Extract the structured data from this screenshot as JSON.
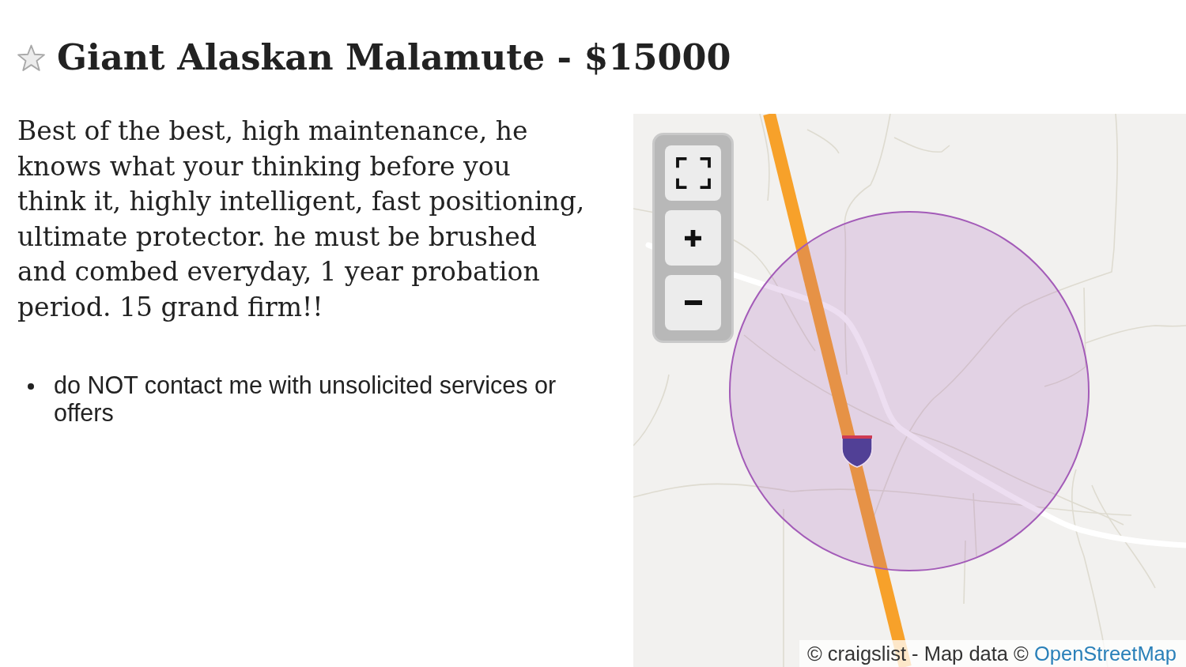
{
  "listing": {
    "starred": false,
    "title": "Giant Alaskan Malamute - $15000"
  },
  "description": "Best of the best, high maintenance, he knows what your thinking before you think it, highly intelligent, fast positioning, ultimate protector. he must be brushed and combed everyday, 1 year probation period. 15 grand firm!!",
  "notices": [
    "do NOT contact me with unsolicited services or offers"
  ],
  "map": {
    "controls": [
      {
        "kind": "fullscreen"
      },
      {
        "kind": "zoom_in"
      },
      {
        "kind": "zoom_out"
      }
    ],
    "attribution": {
      "text": "© craigslist - Map data ©",
      "link": "OpenStreetMap"
    }
  }
}
